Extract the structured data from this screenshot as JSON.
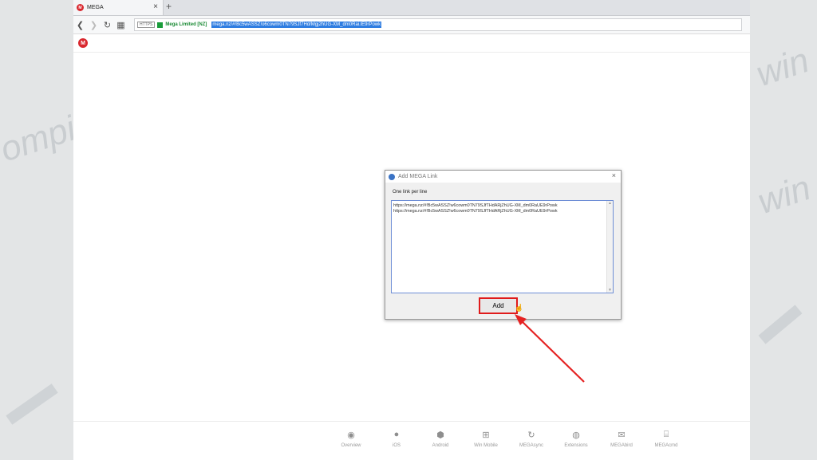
{
  "browser": {
    "tab_title": "MEGA",
    "tab_close": "×",
    "new_tab": "+",
    "https_badge": "HTTPS",
    "site_name": "Mega Limited [NZ]",
    "url": "mega.nz/#!Bc5wASSZ!o6cowm0TN79SJf7Hd/Mgj2hUG-XM_dm0Rai.lE9rPowk"
  },
  "app": {
    "logo_letter": "M"
  },
  "dialog": {
    "title": "Add MEGA Link",
    "close": "×",
    "label": "One link per line",
    "lines": [
      "https://mega.nz/#!Bc5wASSZ!w6cowm0TN79SJfTHdARjZhUG-XM_dm0RaUE9rPowk",
      "https://mega.nz/#!Bc5wASSZ!w6cowm0TN79SJfTHdARjZhUG-XM_dm0RaUE9rPowk"
    ],
    "add_button": "Add"
  },
  "footer": {
    "items": [
      {
        "label": "Overview",
        "icon": "mega-icon",
        "glyph": "◉"
      },
      {
        "label": "iOS",
        "icon": "apple-icon",
        "glyph": ""
      },
      {
        "label": "Android",
        "icon": "android-icon",
        "glyph": "⬢"
      },
      {
        "label": "Win Mobile",
        "icon": "windows-icon",
        "glyph": "⊞"
      },
      {
        "label": "MEGAsync",
        "icon": "sync-icon",
        "glyph": "↻"
      },
      {
        "label": "Extensions",
        "icon": "extensions-icon",
        "glyph": "◍"
      },
      {
        "label": "MEGAbird",
        "icon": "mail-icon",
        "glyph": "✉"
      },
      {
        "label": "MEGAcmd",
        "icon": "terminal-icon",
        "glyph": "⌸"
      }
    ]
  },
  "colors": {
    "accent_red": "#d9272e",
    "highlight_border": "#e01b1b",
    "url_selection": "#2f7de1"
  }
}
